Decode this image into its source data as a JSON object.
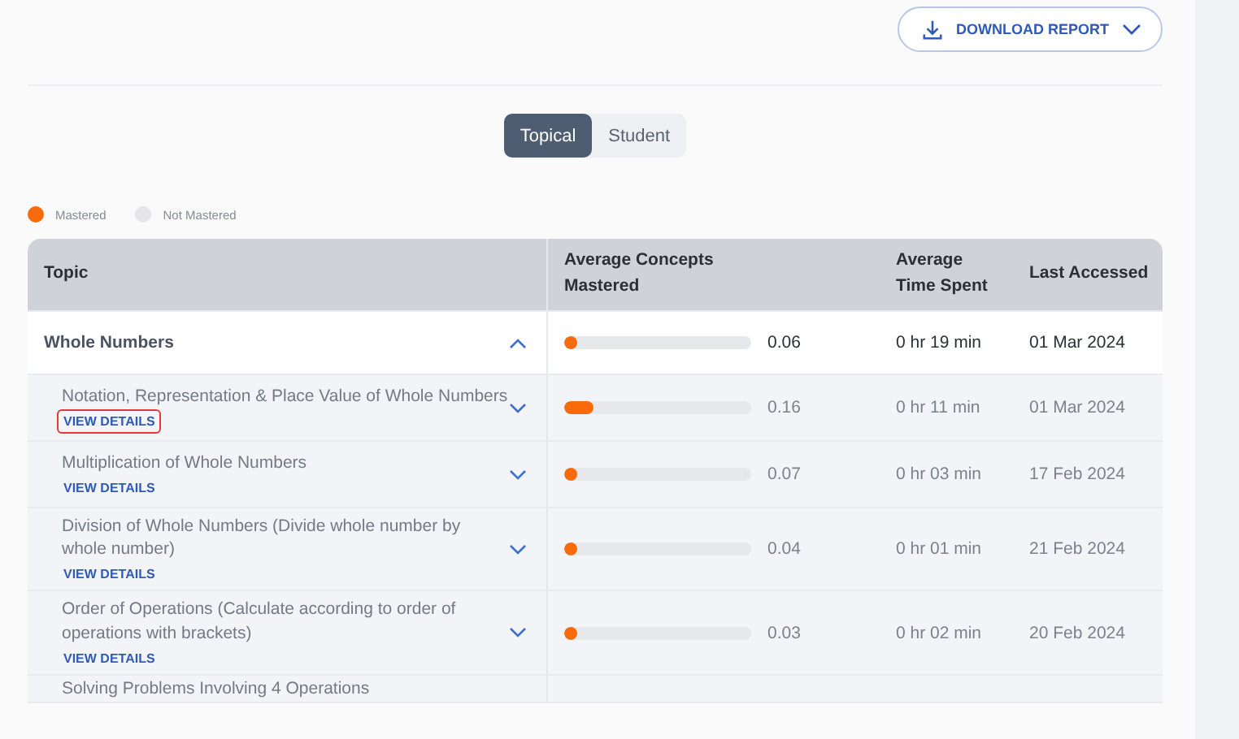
{
  "download_button": {
    "label": "DOWNLOAD REPORT"
  },
  "view_toggle": [
    {
      "label": "Topical",
      "selected": true
    },
    {
      "label": "Student",
      "selected": false
    }
  ],
  "legend": [
    {
      "label": "Mastered",
      "color": "#f76b0c"
    },
    {
      "label": "Not Mastered",
      "color": "#e3e5e8"
    }
  ],
  "table": {
    "columns": [
      "Topic",
      "Average Concepts Mastered",
      "Average Time Spent",
      "Last Accessed"
    ],
    "rows": [
      {
        "topic": "Whole Numbers",
        "expanded": true,
        "level": 0.06,
        "score": "0.06",
        "time": "0 hr 19 min",
        "last_accessed": "01 Mar 2024",
        "children": [
          {
            "topic": "Notation, Representation & Place Value of Whole Numbers",
            "link": "VIEW DETAILS",
            "highlighted": true,
            "expanded": false,
            "level": 0.16,
            "score": "0.16",
            "time": "0 hr 11 min",
            "last_accessed": "01 Mar 2024"
          },
          {
            "topic": "Multiplication of Whole Numbers",
            "link": "VIEW DETAILS",
            "highlighted": false,
            "expanded": false,
            "level": 0.07,
            "score": "0.07",
            "time": "0 hr 03 min",
            "last_accessed": "17 Feb 2024"
          },
          {
            "topic": "Division of Whole Numbers (Divide whole number by whole number)",
            "link": "VIEW DETAILS",
            "highlighted": false,
            "expanded": false,
            "level": 0.04,
            "score": "0.04",
            "time": "0 hr 01 min",
            "last_accessed": "21 Feb 2024"
          },
          {
            "topic": "Order of Operations (Calculate according to order of operations with brackets)",
            "link": "VIEW DETAILS",
            "highlighted": false,
            "expanded": false,
            "level": 0.03,
            "score": "0.03",
            "time": "0 hr 02 min",
            "last_accessed": "20 Feb 2024"
          },
          {
            "topic": "Solving Problems Involving 4 Operations"
          }
        ]
      }
    ]
  }
}
